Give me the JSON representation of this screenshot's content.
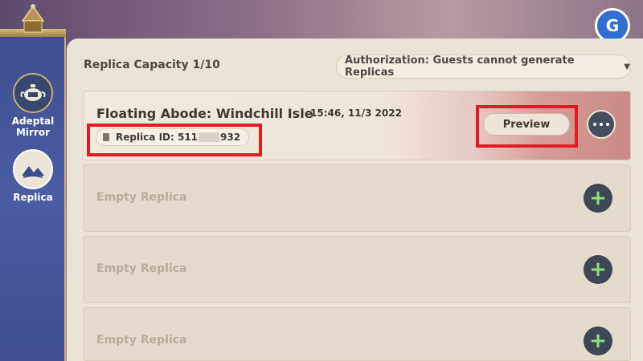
{
  "sidebar": {
    "items": [
      {
        "label_line1": "Adeptal",
        "label_line2": "Mirror",
        "icon": "teapot-icon"
      },
      {
        "label": "Replica",
        "icon": "replica-icon"
      }
    ]
  },
  "header": {
    "capacity": "Replica Capacity 1/10",
    "authorization": "Authorization: Guests cannot generate Replicas"
  },
  "slots": {
    "filled": {
      "title": "Floating Abode: Windchill Isle",
      "time": "15:46, 11/3 2022",
      "replica_id_prefix": "Replica ID: 511",
      "replica_id_suffix": "932",
      "preview_label": "Preview"
    },
    "empty_label": "Empty Replica"
  },
  "colors": {
    "highlight": "#e21b23",
    "add_plus": "#8fe07d",
    "sidebar": "#4a5ca3",
    "panel": "#ebe3d6"
  }
}
